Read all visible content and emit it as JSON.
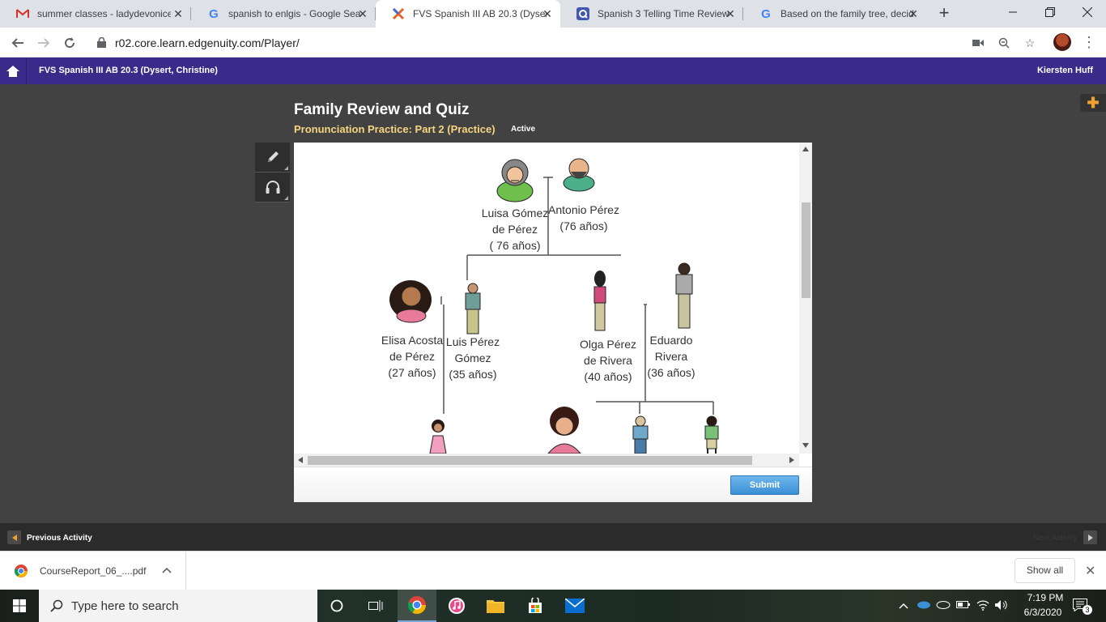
{
  "browser": {
    "tabs": [
      {
        "title": "summer classes - ladydevonice",
        "favicon": "gmail-icon"
      },
      {
        "title": "spanish to enlgis - Google Sea",
        "favicon": "google-icon"
      },
      {
        "title": "FVS Spanish III AB 20.3 (Dysert",
        "favicon": "edgenuity-icon",
        "active": true
      },
      {
        "title": "Spanish 3 Telling Time Review",
        "favicon": "quizlet-icon"
      },
      {
        "title": "Based on the family tree, decid",
        "favicon": "google-icon"
      }
    ],
    "url": "r02.core.learn.edgenuity.com/Player/"
  },
  "app": {
    "course_title": "FVS Spanish III AB 20.3 (Dysert, Christine)",
    "user_name": "Kiersten Huff",
    "accent_color": "#3a2a8a"
  },
  "activity": {
    "title": "Family Review and Quiz",
    "subtitle": "Pronunciation Practice: Part 2 (Practice)",
    "status": "Active",
    "submit_label": "Submit"
  },
  "family_tree": {
    "grandmother": {
      "name": [
        "Luisa Gómez",
        "de Pérez"
      ],
      "age": "( 76 años)"
    },
    "grandfather": {
      "name": [
        "Antonio Pérez"
      ],
      "age": "(76 años)"
    },
    "elisa": {
      "name": [
        "Elisa Acosta",
        "de Pérez"
      ],
      "age": "(27 años)"
    },
    "luis": {
      "name": [
        "Luis Pérez",
        "Gómez"
      ],
      "age": "(35 años)"
    },
    "olga": {
      "name": [
        "Olga Pérez",
        "de Rivera"
      ],
      "age": "(40 años)"
    },
    "eduardo": {
      "name": [
        "Eduardo",
        "Rivera"
      ],
      "age": "(36 años)"
    }
  },
  "nav": {
    "previous_label": "Previous Activity",
    "next_label": "Next Activity"
  },
  "downloads": {
    "file_name": "CourseReport_06_....pdf",
    "show_all_label": "Show all"
  },
  "taskbar": {
    "search_placeholder": "Type here to search",
    "time": "7:19 PM",
    "date": "6/3/2020",
    "notifications": "3"
  }
}
